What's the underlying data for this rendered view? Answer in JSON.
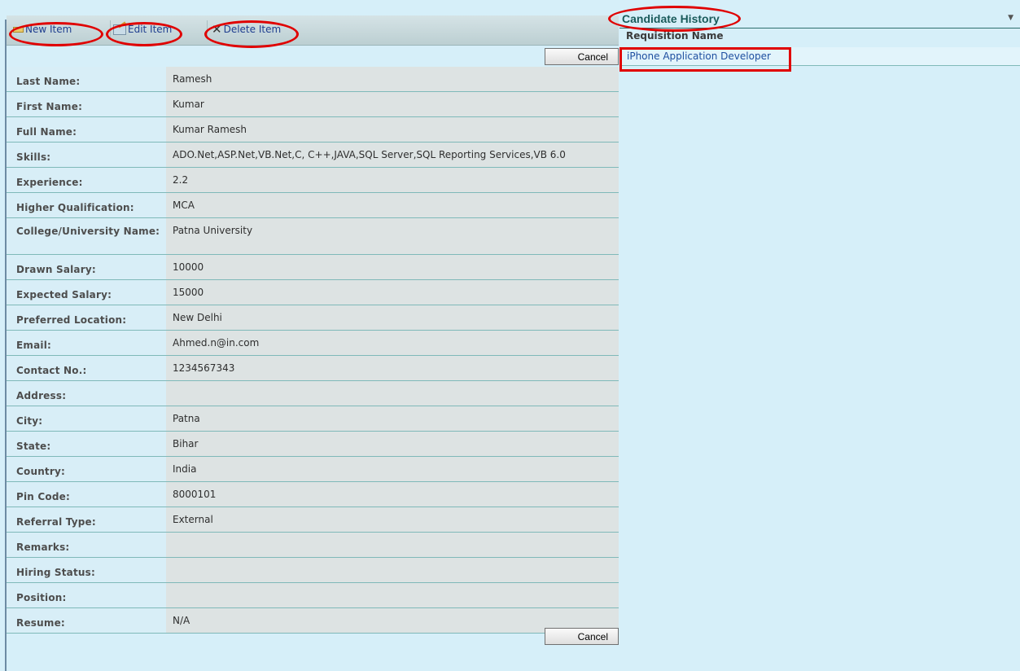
{
  "toolbar": {
    "new_item": "New Item",
    "edit_item": "Edit Item",
    "delete_item": "Delete Item"
  },
  "buttons": {
    "cancel": "Cancel"
  },
  "form": [
    {
      "label": "Last Name:",
      "value": "Ramesh"
    },
    {
      "label": "First Name:",
      "value": "Kumar"
    },
    {
      "label": "Full Name:",
      "value": "Kumar Ramesh"
    },
    {
      "label": "Skills:",
      "value": "ADO.Net,ASP.Net,VB.Net,C, C++,JAVA,SQL Server,SQL Reporting Services,VB 6.0"
    },
    {
      "label": "Experience:",
      "value": "2.2"
    },
    {
      "label": "Higher Qualification:",
      "value": "MCA"
    },
    {
      "label": "College/University Name:",
      "value": "Patna University"
    },
    {
      "label": "Drawn Salary:",
      "value": "10000"
    },
    {
      "label": "Expected Salary:",
      "value": "15000"
    },
    {
      "label": "Preferred Location:",
      "value": "New Delhi"
    },
    {
      "label": "Email:",
      "value": "Ahmed.n@in.com"
    },
    {
      "label": "Contact No.:",
      "value": "1234567343"
    },
    {
      "label": "Address:",
      "value": ""
    },
    {
      "label": "City:",
      "value": "Patna"
    },
    {
      "label": "State:",
      "value": "Bihar"
    },
    {
      "label": "Country:",
      "value": "India"
    },
    {
      "label": "Pin Code:",
      "value": "8000101"
    },
    {
      "label": "Referral Type:",
      "value": "External"
    },
    {
      "label": "Remarks:",
      "value": ""
    },
    {
      "label": "Hiring Status:",
      "value": ""
    },
    {
      "label": "Position:",
      "value": ""
    },
    {
      "label": "Resume:",
      "value": "N/A"
    }
  ],
  "history": {
    "title": "Candidate History",
    "column": "Requisition Name",
    "rows": [
      "iPhone Application Developer"
    ]
  },
  "colors": {
    "page_bg": "#d6eff9",
    "label_bg": "#d8eef7",
    "value_bg": "#dde3e3",
    "link": "#1e4fa0",
    "highlight": "#e00000"
  }
}
